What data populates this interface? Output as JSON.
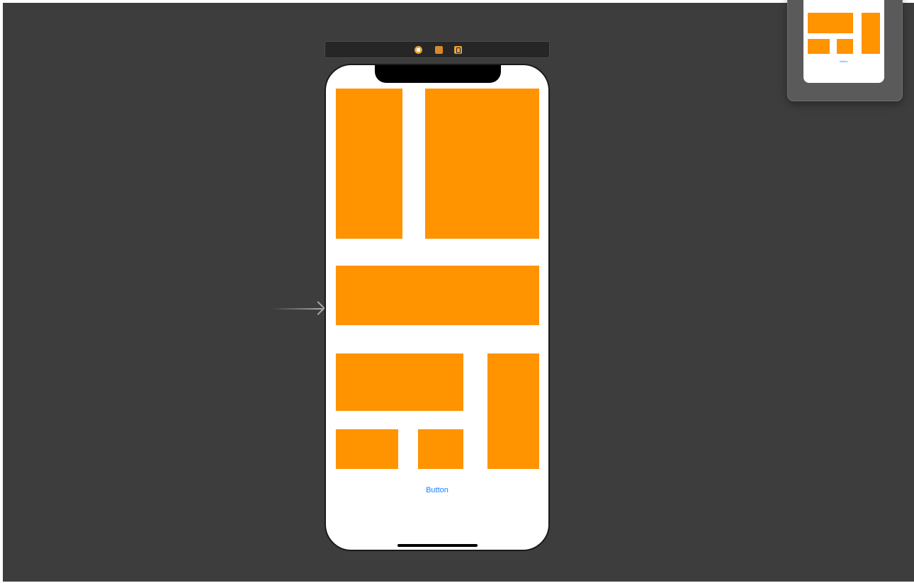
{
  "canvas": {
    "background": "#3d3d3d"
  },
  "scene_dock": {
    "icons": [
      "view-controller-icon",
      "first-responder-icon",
      "exit-icon"
    ]
  },
  "entry_point": {
    "icon": "storyboard-entry-arrow-icon"
  },
  "device": {
    "accent_color": "#ff9300",
    "tint_color": "#1a82fb",
    "button_label": "Button",
    "views": [
      {
        "name": "orange-view-top-left"
      },
      {
        "name": "orange-view-top-right"
      },
      {
        "name": "orange-view-middle-wide"
      },
      {
        "name": "orange-view-lower-left-wide"
      },
      {
        "name": "orange-view-right-tall"
      },
      {
        "name": "orange-view-bottom-left-small"
      },
      {
        "name": "orange-view-bottom-middle-small"
      }
    ]
  },
  "minimap": {
    "button_label": "Button"
  }
}
